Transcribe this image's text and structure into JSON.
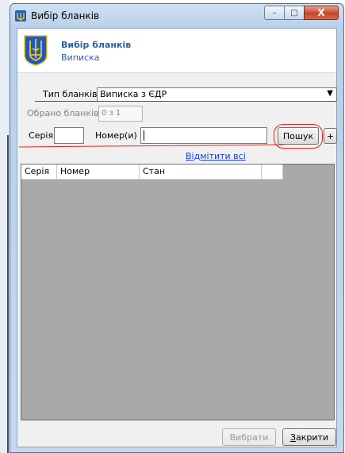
{
  "window": {
    "title": "Вибір бланків",
    "controls": {
      "minimize": "–",
      "maximize": "□",
      "close": "X"
    }
  },
  "header": {
    "title": "Вибір бланків",
    "subtitle": "Виписка"
  },
  "form": {
    "blank_type_label": "Тип бланків",
    "blank_type_value": "Виписка з ЄДР",
    "selected_label": "Обрано бланків",
    "selected_value": "0 з 1",
    "series_label": "Серія",
    "series_value": "",
    "number_label": "Номер(и)",
    "number_value": "",
    "search_button": "Пошук",
    "add_button": "+",
    "select_all_link": "Відмітити всі"
  },
  "table": {
    "columns": [
      "Серія",
      "Номер",
      "Стан",
      ""
    ]
  },
  "footer": {
    "choose_button": "Вибрати",
    "close_button": "Закрити",
    "close_accel": "З",
    "close_rest": "акрити"
  },
  "colors": {
    "annotation": "#e02020",
    "header_text": "#2a5fa8",
    "grid_background": "#a9a9a9",
    "link": "#1a3dd6"
  }
}
